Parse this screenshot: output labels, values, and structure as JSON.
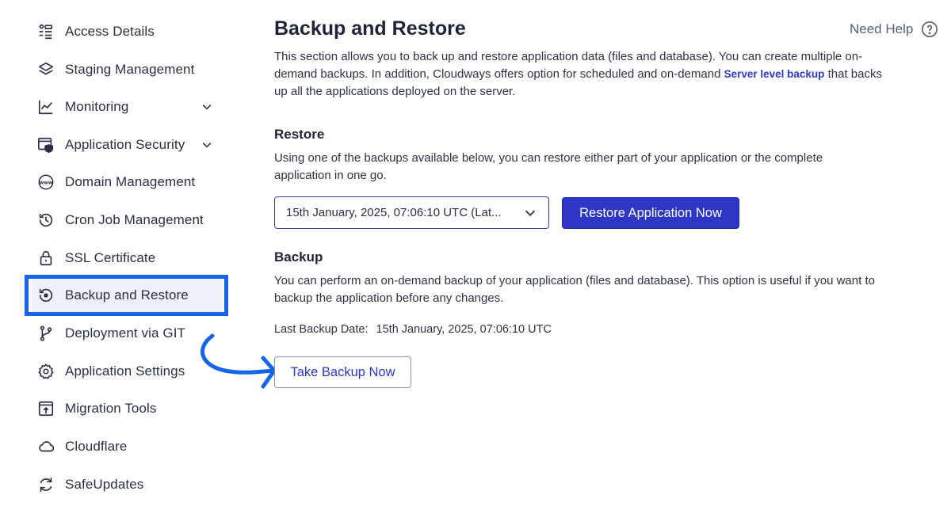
{
  "sidebar": {
    "items": [
      {
        "label": "Access Details",
        "icon": "access-details-icon"
      },
      {
        "label": "Staging Management",
        "icon": "layers-icon"
      },
      {
        "label": "Monitoring",
        "icon": "chart-line-icon",
        "expandable": true
      },
      {
        "label": "Application Security",
        "icon": "shield-browser-icon",
        "expandable": true
      },
      {
        "label": "Domain Management",
        "icon": "www-globe-icon"
      },
      {
        "label": "Cron Job Management",
        "icon": "history-clock-icon"
      },
      {
        "label": "SSL Certificate",
        "icon": "lock-icon"
      },
      {
        "label": "Backup and Restore",
        "icon": "backup-restore-icon",
        "active": true
      },
      {
        "label": "Deployment via GIT",
        "icon": "git-branch-icon"
      },
      {
        "label": "Application Settings",
        "icon": "gear-icon"
      },
      {
        "label": "Migration Tools",
        "icon": "upload-box-icon"
      },
      {
        "label": "Cloudflare",
        "icon": "cloud-icon"
      },
      {
        "label": "SafeUpdates",
        "icon": "refresh-icon"
      }
    ]
  },
  "header": {
    "title": "Backup and Restore",
    "help_label": "Need Help"
  },
  "intro": {
    "text_before": "This section allows you to back up and restore application data (files and database). You can create multiple on-demand backups. In addition, Cloudways offers option for scheduled and on-demand ",
    "link_text": "Server level backup",
    "text_after": " that backs up all the applications deployed on the server."
  },
  "restore": {
    "title": "Restore",
    "description": "Using one of the backups available below, you can restore either part of your application or the complete application in one go.",
    "selected_backup": "15th January, 2025, 07:06:10 UTC (Lat...",
    "button_label": "Restore Application Now"
  },
  "backup": {
    "title": "Backup",
    "description": "You can perform an on-demand backup of your application (files and database). This option is useful if you want to backup the application before any changes.",
    "last_backup_label": "Last Backup Date:",
    "last_backup_value": "15th January, 2025, 07:06:10 UTC",
    "button_label": "Take Backup Now"
  },
  "colors": {
    "accent": "#2e37c5",
    "highlight": "#1565e8",
    "text": "#1f2337"
  }
}
